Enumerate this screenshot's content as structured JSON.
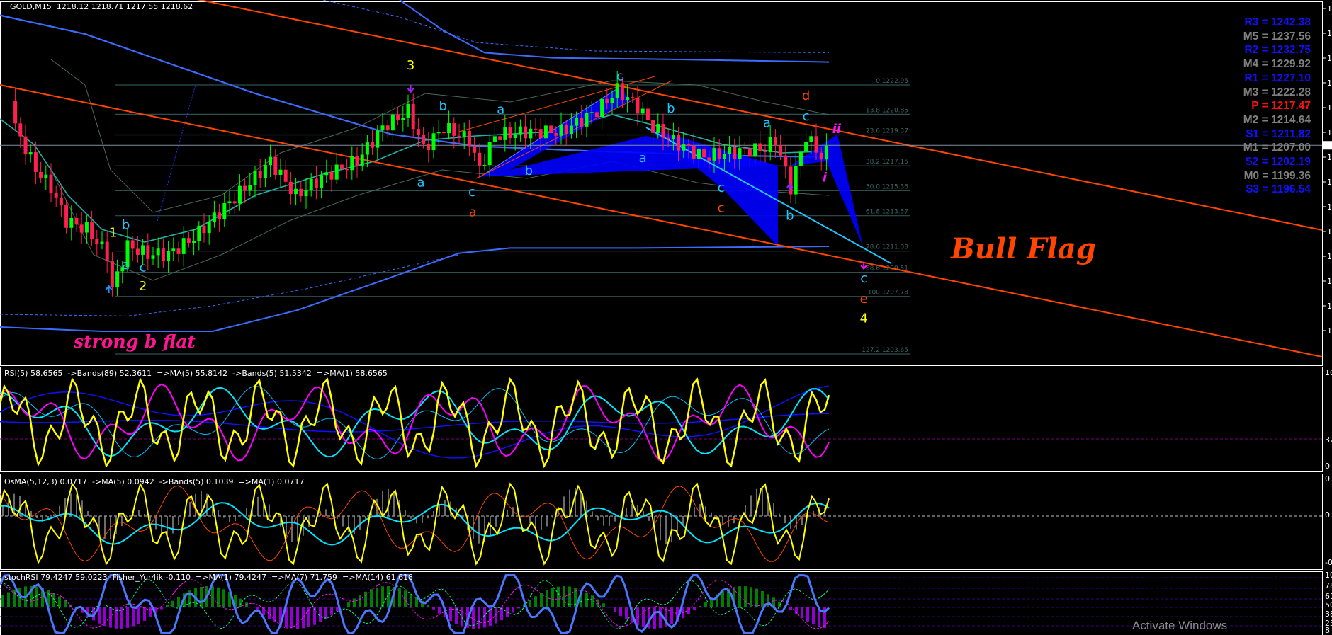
{
  "window": {
    "symbol_header": "GOLD,M15  1218.12 1218.71 1217.55 1218.62"
  },
  "pivots": [
    {
      "label": "R3 = 1242.38",
      "color": "#1010ff"
    },
    {
      "label": "M5 = 1237.56",
      "color": "#808080"
    },
    {
      "label": "R2 = 1232.75",
      "color": "#1010ff"
    },
    {
      "label": "M4 = 1229.92",
      "color": "#808080"
    },
    {
      "label": "R1 = 1227.10",
      "color": "#1010ff"
    },
    {
      "label": "M3 = 1222.28",
      "color": "#808080"
    },
    {
      "label": "P   = 1217.47",
      "color": "#ff1010"
    },
    {
      "label": "M2 = 1214.64",
      "color": "#808080"
    },
    {
      "label": "S1 = 1211.82",
      "color": "#1010ff"
    },
    {
      "label": "M1 = 1207.00",
      "color": "#808080"
    },
    {
      "label": "S2 = 1202.19",
      "color": "#1010ff"
    },
    {
      "label": "M0 = 1199.36",
      "color": "#808080"
    },
    {
      "label": "S3 = 1196.54",
      "color": "#1010ff"
    }
  ],
  "annotations": {
    "strong_b_flat": "strong b flat",
    "bull_flag": "Bull Flag"
  },
  "watermark": "Activate Windows",
  "chart_data": [
    {
      "type": "candlestick",
      "symbol": "GOLD",
      "timeframe": "M15",
      "ohlc_last": {
        "open": 1218.12,
        "high": 1218.71,
        "low": 1217.55,
        "close": 1218.62
      },
      "current_price": 1218.62,
      "price_path": [
        [
          2,
          1222.3
        ],
        [
          3,
          1219.9
        ],
        [
          7,
          1216.9
        ],
        [
          10,
          1215.6
        ],
        [
          13,
          1213.2
        ],
        [
          17,
          1212.6
        ],
        [
          21,
          1210.8
        ],
        [
          22,
          1208.3
        ],
        [
          25,
          1211.4
        ],
        [
          29,
          1210.8
        ],
        [
          33,
          1210.8
        ],
        [
          38,
          1212.0
        ],
        [
          43,
          1213.8
        ],
        [
          50,
          1216.3
        ],
        [
          53,
          1217.5
        ],
        [
          58,
          1215.0
        ],
        [
          63,
          1216.3
        ],
        [
          70,
          1217.5
        ],
        [
          75,
          1219.9
        ],
        [
          80,
          1221.1
        ],
        [
          83,
          1218.4
        ],
        [
          87,
          1219.9
        ],
        [
          92,
          1219.0
        ],
        [
          94,
          1216.9
        ],
        [
          97,
          1219.3
        ],
        [
          103,
          1219.6
        ],
        [
          110,
          1219.6
        ],
        [
          117,
          1221.1
        ],
        [
          121,
          1222.6
        ],
        [
          125,
          1221.4
        ],
        [
          128,
          1219.9
        ],
        [
          133,
          1218.7
        ],
        [
          138,
          1217.8
        ],
        [
          143,
          1218.1
        ],
        [
          150,
          1218.4
        ],
        [
          152,
          1219.0
        ],
        [
          155,
          1215.6
        ],
        [
          158,
          1219.3
        ],
        [
          161,
          1217.8
        ],
        [
          162,
          1218.6
        ]
      ],
      "ylim": [
        1201.5,
        1229.0
      ],
      "fibonacci": [
        {
          "label": "0 1222.95",
          "price": 1222.95
        },
        {
          "label": "13.8 1220.85",
          "price": 1220.85
        },
        {
          "label": "23.6 1219.37",
          "price": 1219.37
        },
        {
          "label": "38.2 1217.15",
          "price": 1217.15
        },
        {
          "label": "50.0 1215.36",
          "price": 1215.36
        },
        {
          "label": "61.8 1213.57",
          "price": 1213.57
        },
        {
          "label": "78.6 1211.03",
          "price": 1211.03
        },
        {
          "label": "88.6 1209.51",
          "price": 1209.51
        },
        {
          "label": "100 1207.78",
          "price": 1207.78
        },
        {
          "label": "127.2 1203.65",
          "price": 1203.65
        }
      ],
      "wave_labels": [
        {
          "t": "3",
          "c": "#ffff00",
          "x": 483,
          "y": 75
        },
        {
          "t": "1",
          "c": "#ffff00",
          "x": 133,
          "y": 272
        },
        {
          "t": "2",
          "c": "#ffff00",
          "x": 168,
          "y": 335
        },
        {
          "t": "4",
          "c": "#ffff00",
          "x": 1016,
          "y": 373
        },
        {
          "t": "b",
          "c": "#1ec8ff",
          "x": 148,
          "y": 263
        },
        {
          "t": "a",
          "c": "#1ec8ff",
          "x": 148,
          "y": 310
        },
        {
          "t": "c",
          "c": "#1ec8ff",
          "x": 168,
          "y": 313
        },
        {
          "t": "b",
          "c": "#1ec8ff",
          "x": 521,
          "y": 123
        },
        {
          "t": "a",
          "c": "#1ec8ff",
          "x": 589,
          "y": 127
        },
        {
          "t": "a",
          "c": "#1ec8ff",
          "x": 495,
          "y": 213
        },
        {
          "t": "c",
          "c": "#1ec8ff",
          "x": 555,
          "y": 224
        },
        {
          "t": "a",
          "c": "#ff4500",
          "x": 556,
          "y": 248
        },
        {
          "t": "b",
          "c": "#1ec8ff",
          "x": 622,
          "y": 199
        },
        {
          "t": "c",
          "c": "#1ec8ff",
          "x": 729,
          "y": 88
        },
        {
          "t": "b",
          "c": "#1ec8ff",
          "x": 789,
          "y": 126
        },
        {
          "t": "a",
          "c": "#1ec8ff",
          "x": 756,
          "y": 184
        },
        {
          "t": "c",
          "c": "#1ec8ff",
          "x": 848,
          "y": 219
        },
        {
          "t": "c",
          "c": "#ff4500",
          "x": 848,
          "y": 243
        },
        {
          "t": "a",
          "c": "#1ec8ff",
          "x": 902,
          "y": 143
        },
        {
          "t": "d",
          "c": "#ff4500",
          "x": 948,
          "y": 111
        },
        {
          "t": "c",
          "c": "#1ec8ff",
          "x": 948,
          "y": 135
        },
        {
          "t": "ii",
          "c": "#ff10ff",
          "x": 984,
          "y": 150
        },
        {
          "t": "i",
          "c": "#ff10ff",
          "x": 970,
          "y": 207
        },
        {
          "t": "b",
          "c": "#1ec8ff",
          "x": 929,
          "y": 252
        },
        {
          "t": "c",
          "c": "#1ec8ff",
          "x": 1016,
          "y": 326
        },
        {
          "t": "e",
          "c": "#ff4500",
          "x": 1016,
          "y": 350
        }
      ],
      "colors": {
        "bull": "#00ff00",
        "bear": "#ff2050",
        "channel": "#ff4500",
        "ma": "#3c6cff",
        "harmonic": "#0000ff",
        "fib": "#2f4f4f"
      }
    },
    {
      "type": "line",
      "panel": "RSI",
      "header": "RSI(5) 58.6565  ->Bands(89) 52.3611  =>MA(5) 55.8142  ->Bands(5) 51.5342  =>MA(1) 58.6565",
      "axis": [
        "100",
        "32",
        "0"
      ]
    },
    {
      "type": "line",
      "panel": "OsMA",
      "header": "OsMA(5,12,3) 0.0717  ->MA(5) 0.0942  ->Bands(5) 0.1039  =>MA(1) 0.0717",
      "axis": [
        "0.",
        "0.",
        "-0"
      ]
    },
    {
      "type": "line",
      "panel": "stochRSI",
      "header": "stochRSI 79.4247 59.0223  Fisher_Yur4ik -0.110  =>MA(1) 79.4247  =>MA(7) 71.759  =>MA(14) 61.618",
      "axis": [
        "100",
        "78",
        "61",
        "50",
        "38",
        "23",
        "8"
      ]
    }
  ]
}
